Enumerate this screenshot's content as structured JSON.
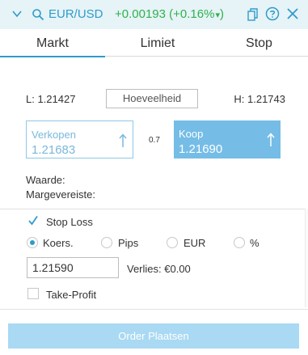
{
  "header": {
    "pair": "EUR/USD",
    "change": "+0.00193 (+0.16%",
    "change_arrow": "▾",
    "change_close": ")",
    "icons": [
      "chevron-down-icon",
      "search-icon",
      "copy-icon",
      "help-icon",
      "close-icon"
    ]
  },
  "tabs": [
    {
      "label": "Markt",
      "active": true
    },
    {
      "label": "Limiet",
      "active": false
    },
    {
      "label": "Stop",
      "active": false
    }
  ],
  "quantity": {
    "low": "L: 1.21427",
    "placeholder": "Hoeveelheid",
    "high": "H: 1.21743"
  },
  "sell": {
    "label": "Verkopen",
    "price": "1.21683"
  },
  "spread": "0.7",
  "buy": {
    "label": "Koop",
    "price": "1.21690"
  },
  "info": {
    "waarde": "Waarde:",
    "marge": "Margevereiste:"
  },
  "stop_loss": {
    "label": "Stop Loss",
    "checked": true,
    "options": [
      {
        "label": "Koers.",
        "selected": true
      },
      {
        "label": "Pips",
        "selected": false
      },
      {
        "label": "EUR",
        "selected": false
      },
      {
        "label": "%",
        "selected": false
      }
    ],
    "value": "1.21590",
    "loss": "Verlies: €0.00"
  },
  "take_profit": {
    "label": "Take-Profit",
    "checked": false
  },
  "order_button": "Order Plaatsen",
  "colors": {
    "accent": "#2f9cc9",
    "positive": "#2fb24c",
    "buy_bg": "#75bde6",
    "button_bg": "#a9d9f3",
    "header_bg": "#e6f3f7"
  }
}
